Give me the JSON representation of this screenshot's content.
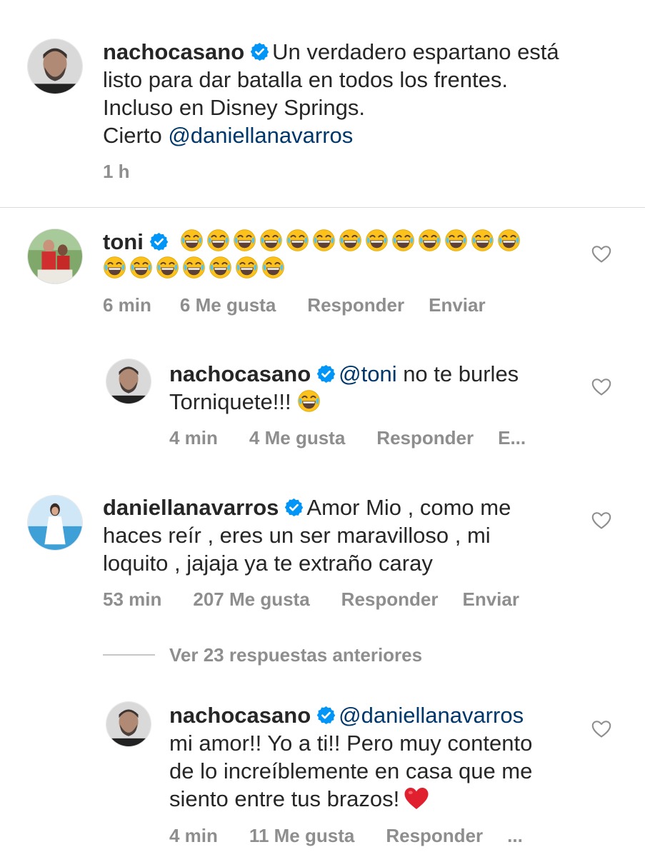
{
  "caption": {
    "username": "nachocasano",
    "line1": "Un verdadero espartano está",
    "line2": "listo para dar batalla en todos los frentes.",
    "line3": "Incluso en Disney Springs.",
    "line4_prefix": "Cierto ",
    "line4_mention": "@daniellanavarros",
    "time": "1 h"
  },
  "comment_toni": {
    "username": "toni",
    "emoji_count_row1": 13,
    "emoji_count_row2": 7,
    "time": "6 min",
    "likes": "6 Me gusta",
    "reply": "Responder",
    "send": "Enviar"
  },
  "reply_nacho_1": {
    "username": "nachocasano",
    "mention": "@toni",
    "text1": " no te burles",
    "text2": "Torniquete!!!",
    "time": "4 min",
    "likes": "4 Me gusta",
    "reply": "Responder",
    "send": "E..."
  },
  "comment_daniella": {
    "username": "daniellanavarros",
    "line1": "Amor Mio , como me",
    "line2": "haces reír , eres un ser maravilloso , mi",
    "line3": "loquito , jajaja ya te extraño caray",
    "time": "53 min",
    "likes": "207 Me gusta",
    "reply": "Responder",
    "send": "Enviar"
  },
  "view_replies": "Ver 23 respuestas anteriores",
  "reply_nacho_2": {
    "username": "nachocasano",
    "mention": "@daniellanavarros",
    "line2": "mi amor!! Yo a ti!! Pero muy contento",
    "line3": "de lo increíblemente en casa que me",
    "line4": "siento entre tus brazos!",
    "time": "4 min",
    "likes": "11 Me gusta",
    "reply": "Responder",
    "send": "..."
  },
  "colors": {
    "text": "#262626",
    "secondary": "#8e8e8e",
    "mention": "#00376b",
    "verified": "#0095f6",
    "heart_red": "#ed4956"
  }
}
